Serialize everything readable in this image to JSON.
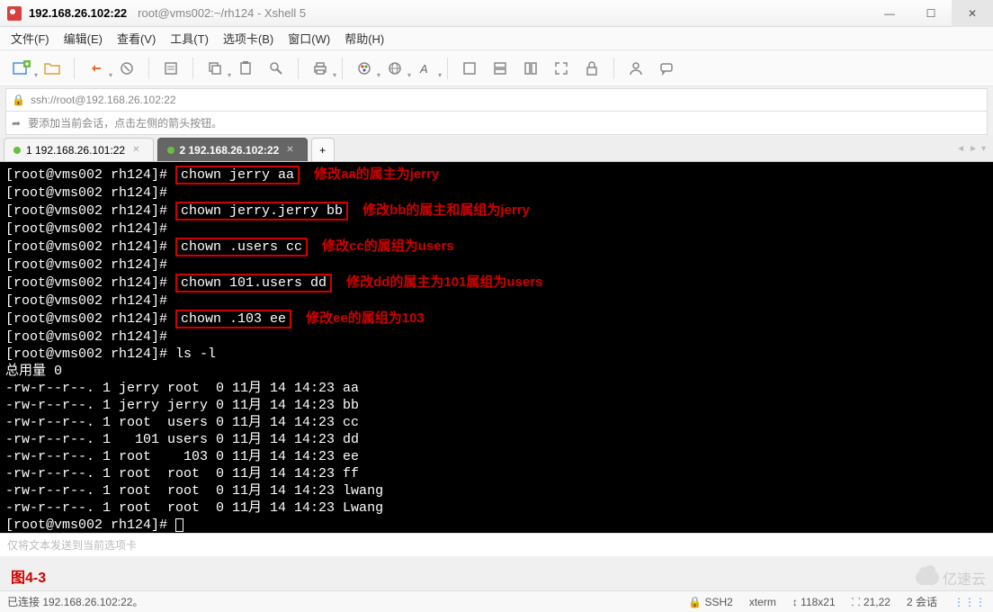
{
  "title": {
    "strong": "192.168.26.102:22",
    "rest": "root@vms002:~/rh124 - Xshell 5"
  },
  "menu": [
    "文件(F)",
    "编辑(E)",
    "查看(V)",
    "工具(T)",
    "选项卡(B)",
    "窗口(W)",
    "帮助(H)"
  ],
  "addressbar": "ssh://root@192.168.26.102:22",
  "hint": "要添加当前会话，点击左侧的箭头按钮。",
  "tabs": [
    {
      "label": "1 192.168.26.101:22",
      "active": false
    },
    {
      "label": "2 192.168.26.102:22",
      "active": true
    }
  ],
  "terminal": {
    "prompt": "[root@vms002 rh124]# ",
    "lines": [
      {
        "cmd": "chown jerry aa",
        "boxed": true,
        "ann": "修改aa的属主为jerry"
      },
      {
        "cmd": "",
        "boxed": false
      },
      {
        "cmd": "chown jerry.jerry bb",
        "boxed": true,
        "ann": "修改bb的属主和属组为jerry"
      },
      {
        "cmd": "",
        "boxed": false
      },
      {
        "cmd": "chown .users cc",
        "boxed": true,
        "ann": "修改cc的属组为users"
      },
      {
        "cmd": "",
        "boxed": false
      },
      {
        "cmd": "chown 101.users dd",
        "boxed": true,
        "ann": "修改dd的属主为101属组为users"
      },
      {
        "cmd": "",
        "boxed": false
      },
      {
        "cmd": "chown .103 ee",
        "boxed": true,
        "ann": "修改ee的属组为103"
      },
      {
        "cmd": "",
        "boxed": false
      },
      {
        "cmd": "ls -l",
        "boxed": false
      }
    ],
    "total": "总用量 0",
    "listing": [
      "-rw-r--r--. 1 jerry root  0 11月 14 14:23 aa",
      "-rw-r--r--. 1 jerry jerry 0 11月 14 14:23 bb",
      "-rw-r--r--. 1 root  users 0 11月 14 14:23 cc",
      "-rw-r--r--. 1   101 users 0 11月 14 14:23 dd",
      "-rw-r--r--. 1 root    103 0 11月 14 14:23 ee",
      "-rw-r--r--. 1 root  root  0 11月 14 14:23 ff",
      "-rw-r--r--. 1 root  root  0 11月 14 14:23 lwang",
      "-rw-r--r--. 1 root  root  0 11月 14 14:23 Lwang"
    ]
  },
  "inputbar_placeholder": "仅将文本发送到当前选项卡",
  "figure_label": "图4-3",
  "status": {
    "left": "已连接 192.168.26.102:22。",
    "ssh": "SSH2",
    "term": "xterm",
    "size": "118x21",
    "pos": "21,22",
    "sessions": "2 会话"
  },
  "watermark": "亿速云"
}
